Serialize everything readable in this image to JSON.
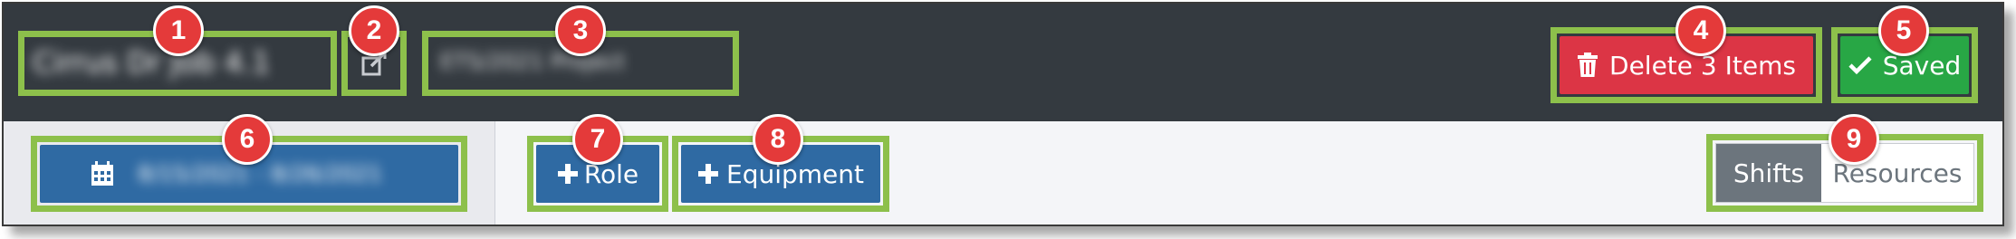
{
  "header": {
    "title_blurred": "Cirrus Dr Job 4.1",
    "subtitle_blurred": "ETS/2021 Project",
    "delete_label": "Delete 3 Items",
    "saved_label": "Saved",
    "delete_color": "#dc3545",
    "saved_color": "#28a745"
  },
  "toolbar": {
    "date_range_blurred": "8/15/2021 - 8/26/2021",
    "role_label": "Role",
    "equipment_label": "Equipment",
    "view_toggle": {
      "options": [
        "Shifts",
        "Resources"
      ],
      "selected": "Shifts"
    },
    "primary_color": "#2f6aa3"
  },
  "callouts": [
    "1",
    "2",
    "3",
    "4",
    "5",
    "6",
    "7",
    "8",
    "9"
  ],
  "highlight_color": "#8dc04b",
  "callout_color": "#e43a3a"
}
